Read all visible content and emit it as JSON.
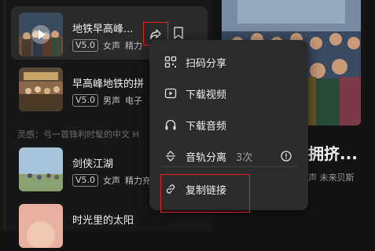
{
  "songs": [
    {
      "title": "地铁早高峰...",
      "version": "V5.0",
      "voice": "女声",
      "tag": "精力",
      "active": true
    },
    {
      "title": "早高峰地铁的拼",
      "version": "V5.0",
      "voice": "男声",
      "tag": "电子",
      "active": false
    },
    {
      "title": "剑侠江湖",
      "version": "V5.0",
      "voice": "女声",
      "tag": "精力充",
      "active": false
    },
    {
      "title": "时光里的太阳",
      "version": "",
      "voice": "",
      "tag": "",
      "active": false
    }
  ],
  "hint_text": "灵感：弓一首锋利时髦的中文 H",
  "right": {
    "title": "拥挤...",
    "subtitle": "声 未来贝斯"
  },
  "menu": {
    "items": [
      {
        "label": "扫码分享",
        "icon": "qr-code-icon"
      },
      {
        "label": "下载视频",
        "icon": "video-icon"
      },
      {
        "label": "下载音频",
        "icon": "headphones-icon"
      },
      {
        "label": "音轨分离",
        "icon": "split-tracks-icon",
        "extra": "3次"
      },
      {
        "label": "复制链接",
        "icon": "link-icon"
      }
    ]
  },
  "colors": {
    "highlight": "#e02020",
    "menu_bg": "#2b2b2b",
    "active_bg": "#2a2a2a"
  }
}
